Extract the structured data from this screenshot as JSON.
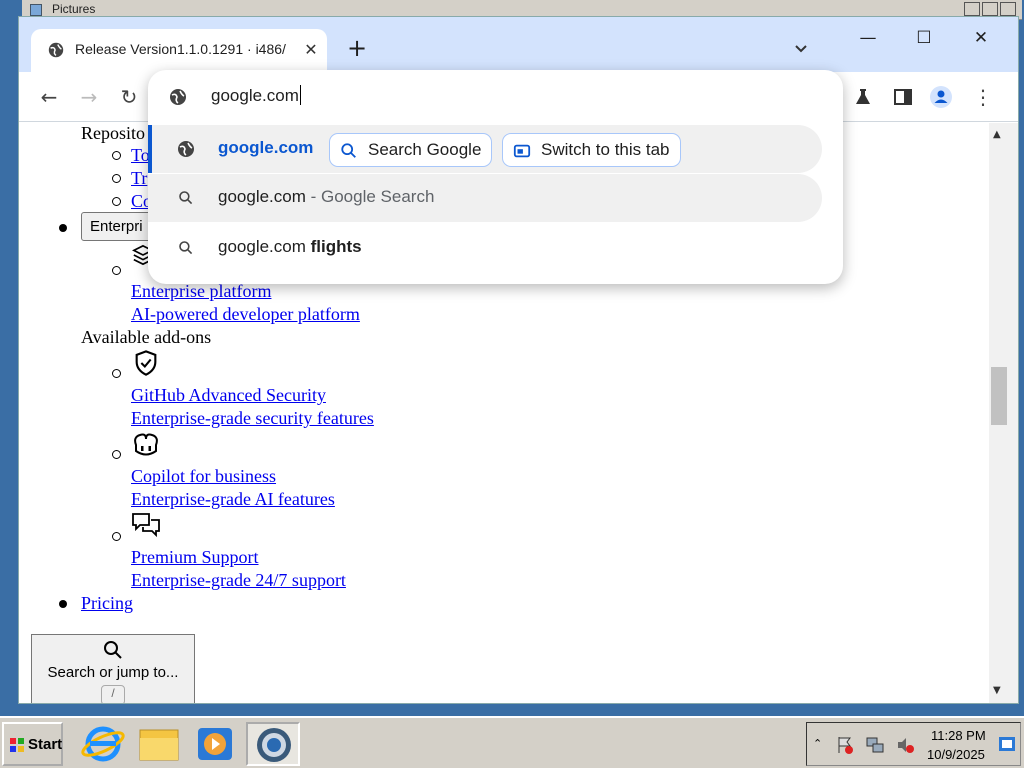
{
  "background_window": {
    "title": "Pictures"
  },
  "browser": {
    "tab": {
      "title": "Release Version1.1.0.1291 · i486/"
    },
    "new_tab_symbol": "+",
    "window_controls": {
      "minimize": "—",
      "maximize": "☐",
      "close": "✕"
    }
  },
  "omnibox": {
    "input_value": "google.com",
    "suggestions": [
      {
        "text": "google.com",
        "icon": "globe-icon",
        "chips": [
          "Search Google",
          "Switch to this tab"
        ]
      },
      {
        "text": "google.com",
        "suffix": " - Google Search",
        "icon": "search-icon"
      },
      {
        "text": "google.com ",
        "bold": "flights",
        "icon": "search-icon"
      }
    ]
  },
  "page": {
    "repository_label": "Reposito",
    "partial_links": [
      "To",
      "Tr",
      "Co"
    ],
    "enterprise_button": "Enterpri",
    "enterprise_platform_link": "Enterprise platform",
    "enterprise_platform_desc": "AI-powered developer platform",
    "addons_heading": "Available add-ons",
    "addons": [
      {
        "icon": "shield-check-icon",
        "title": "GitHub Advanced Security",
        "desc": "Enterprise-grade security features"
      },
      {
        "icon": "copilot-icon",
        "title": "Copilot for business",
        "desc": "Enterprise-grade AI features"
      },
      {
        "icon": "comment-discussion-icon",
        "title": "Premium Support",
        "desc": "Enterprise-grade 24/7 support"
      }
    ],
    "pricing_link": "Pricing",
    "search_jump": {
      "label": "Search or jump to...",
      "shortcut": "/"
    }
  },
  "taskbar": {
    "start_label": "Start",
    "apps": [
      "internet-explorer-icon",
      "explorer-folder-icon",
      "media-player-icon",
      "chrome-icon"
    ],
    "clock": {
      "time": "11:28 PM",
      "date": "10/9/2025"
    }
  }
}
